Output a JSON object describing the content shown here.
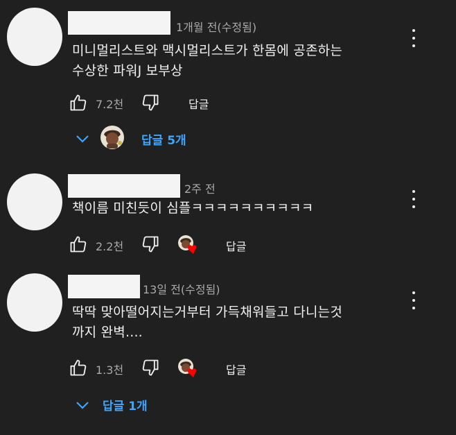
{
  "comments": [
    {
      "time": "1개월 전(수정됨)",
      "lines": [
        "미니멀리스트와 맥시멀리스트가 한몸에 공존하는",
        "수상한 파워J 보부상"
      ],
      "likes": "7.2천",
      "reply_label": "답글",
      "replies_label": "답글 5개"
    },
    {
      "time": "2주 전",
      "lines": [
        "책이름 미친듯이 심플ㅋㅋㅋㅋㅋㅋㅋㅋㅋㅋ"
      ],
      "likes": "2.2천",
      "reply_label": "답글"
    },
    {
      "time": "13일 전(수정됨)",
      "lines": [
        "딱딱 맞아떨어지는거부터 가득채워들고 다니는것",
        "까지 완벽...."
      ],
      "likes": "1.3천",
      "reply_label": "답글",
      "replies_label": "답글 1개"
    }
  ],
  "icons": {
    "like": "thumbs-up-icon",
    "dislike": "thumbs-down-icon",
    "more": "more-vertical-icon",
    "expand": "chevron-down-icon",
    "heart": "heart-icon"
  },
  "colors": {
    "background": "#202020",
    "text": "#f1f1f1",
    "secondary": "#aaaaaa",
    "link": "#3ea6ff",
    "heart": "#ff0000"
  }
}
